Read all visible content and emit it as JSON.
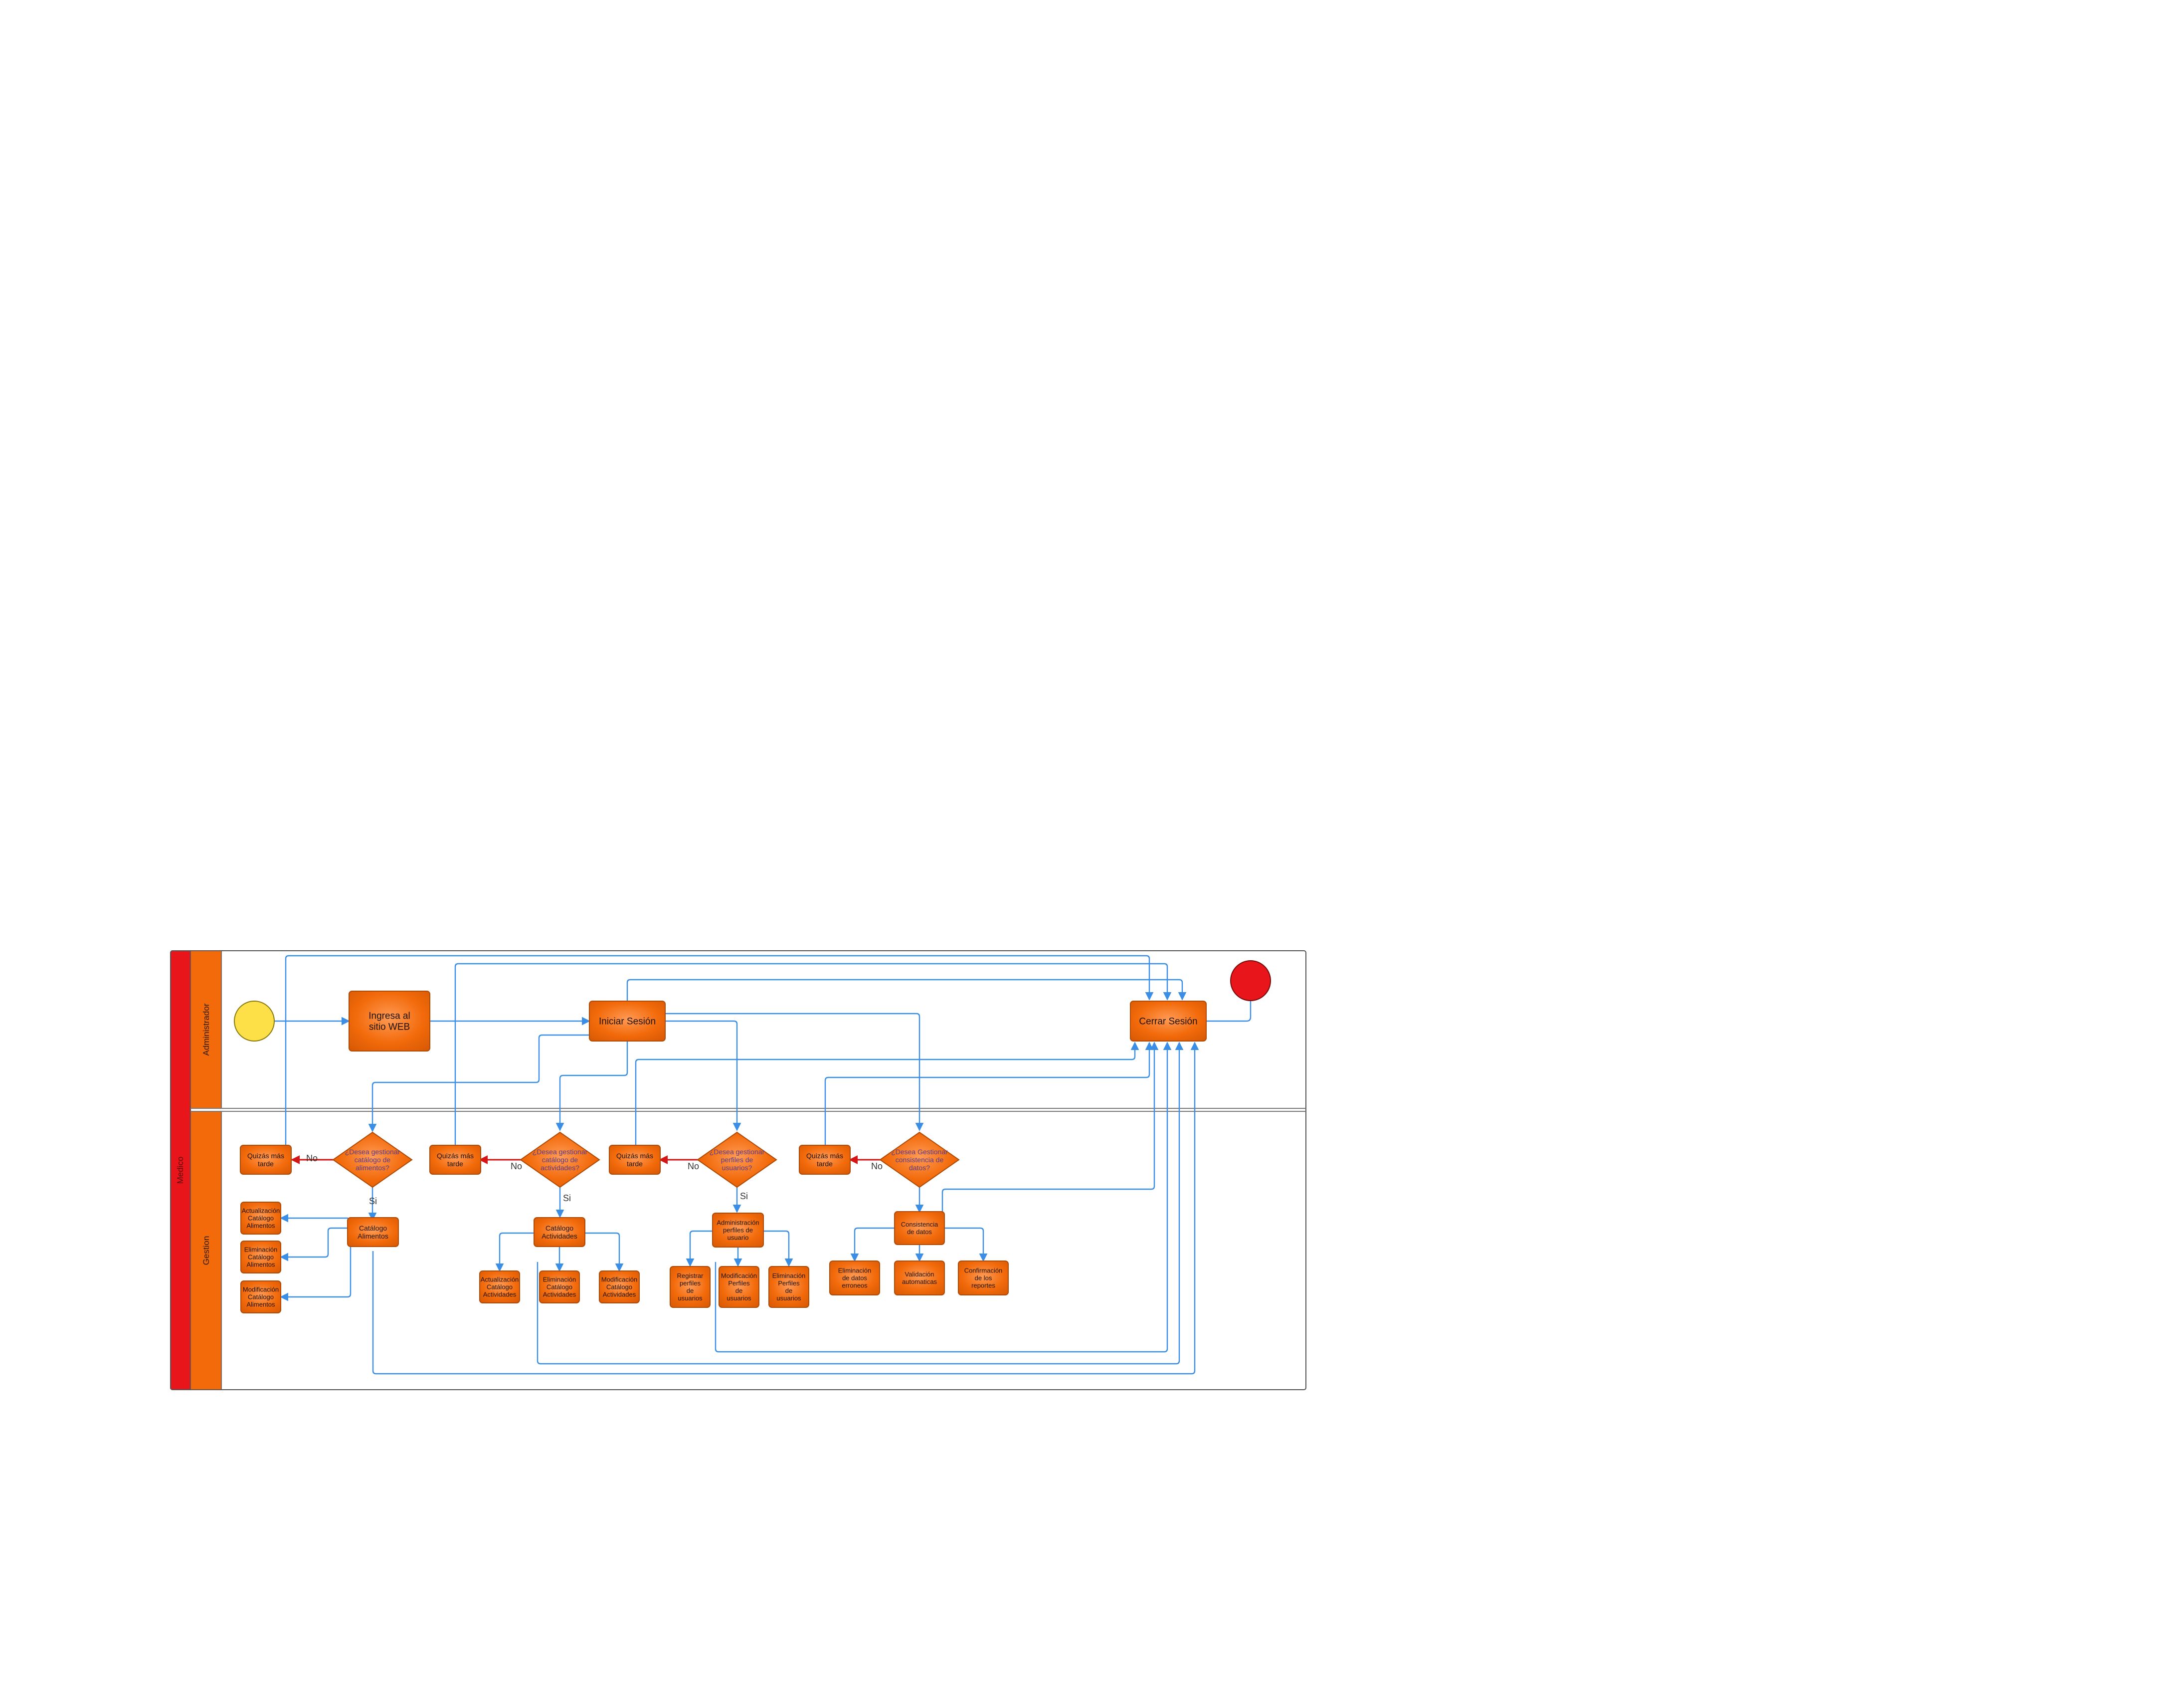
{
  "pool": {
    "label": "Medico",
    "color": "#e8161a"
  },
  "lanes": [
    {
      "id": "admin",
      "label": "Administrador"
    },
    {
      "id": "gestion",
      "label": "Gestion"
    }
  ],
  "colors": {
    "node_fill": "#f26a0a",
    "node_stroke": "#b04a05",
    "connector": "#3a8ee6",
    "no_connector": "#d41616",
    "start": "#fde048",
    "end": "#e8161a"
  },
  "nodes": {
    "start": {
      "type": "start-event"
    },
    "ingresa": {
      "label": "Ingresa al sitio WEB"
    },
    "iniciar": {
      "label": "Iniciar Sesión"
    },
    "cerrar": {
      "label": "Cerrar Sesión"
    },
    "end": {
      "type": "end-event"
    },
    "dec_alimentos": {
      "label": "¿Desea gestionar catálogo de alimentos?"
    },
    "dec_actividades": {
      "label": "¿Desea gestionar catálogo de actividades?"
    },
    "dec_usuarios": {
      "label": "¿Desea gestionar perfiles de usuarios?"
    },
    "dec_datos": {
      "label": "¿Desea Gestionar consistencia de datos?"
    },
    "quiza1": {
      "label": "Quizás más tarde"
    },
    "quiza2": {
      "label": "Quizás más tarde"
    },
    "quiza3": {
      "label": "Quizás más tarde"
    },
    "quiza4": {
      "label": "Quizás más tarde"
    },
    "cat_alimentos": {
      "label": "Catálogo Alimentos"
    },
    "act_alimentos": {
      "label": "Actualización Catálogo Alimentos"
    },
    "elim_alimentos": {
      "label": "Eliminación Catálogo Alimentos"
    },
    "mod_alimentos": {
      "label": "Modificación Catálogo Alimentos"
    },
    "cat_actividades": {
      "label": "Catálogo Actividades"
    },
    "act_actividades": {
      "label": "Actualización Catálogo Actividades"
    },
    "elim_actividades": {
      "label": "Eliminación Catálogo Actividades"
    },
    "mod_actividades": {
      "label": "Modificación Catálogo Actividades"
    },
    "admin_perfiles": {
      "label": "Administración perfiles de usuario"
    },
    "reg_perfiles": {
      "label": "Registrar perfiles de usuarios"
    },
    "mod_perfiles": {
      "label": "Modificación Perfiles de usuarios"
    },
    "elim_perfiles": {
      "label": "Eliminación Perfiles de usuarios"
    },
    "consistencia": {
      "label": "Consistencia de datos"
    },
    "elim_erroneos": {
      "label": "Eliminación de datos erroneos"
    },
    "validacion": {
      "label": "Validación automaticas"
    },
    "confirmacion": {
      "label": "Confirmación de los reportes"
    }
  },
  "edge_labels": {
    "no": "No",
    "si": "Si"
  }
}
